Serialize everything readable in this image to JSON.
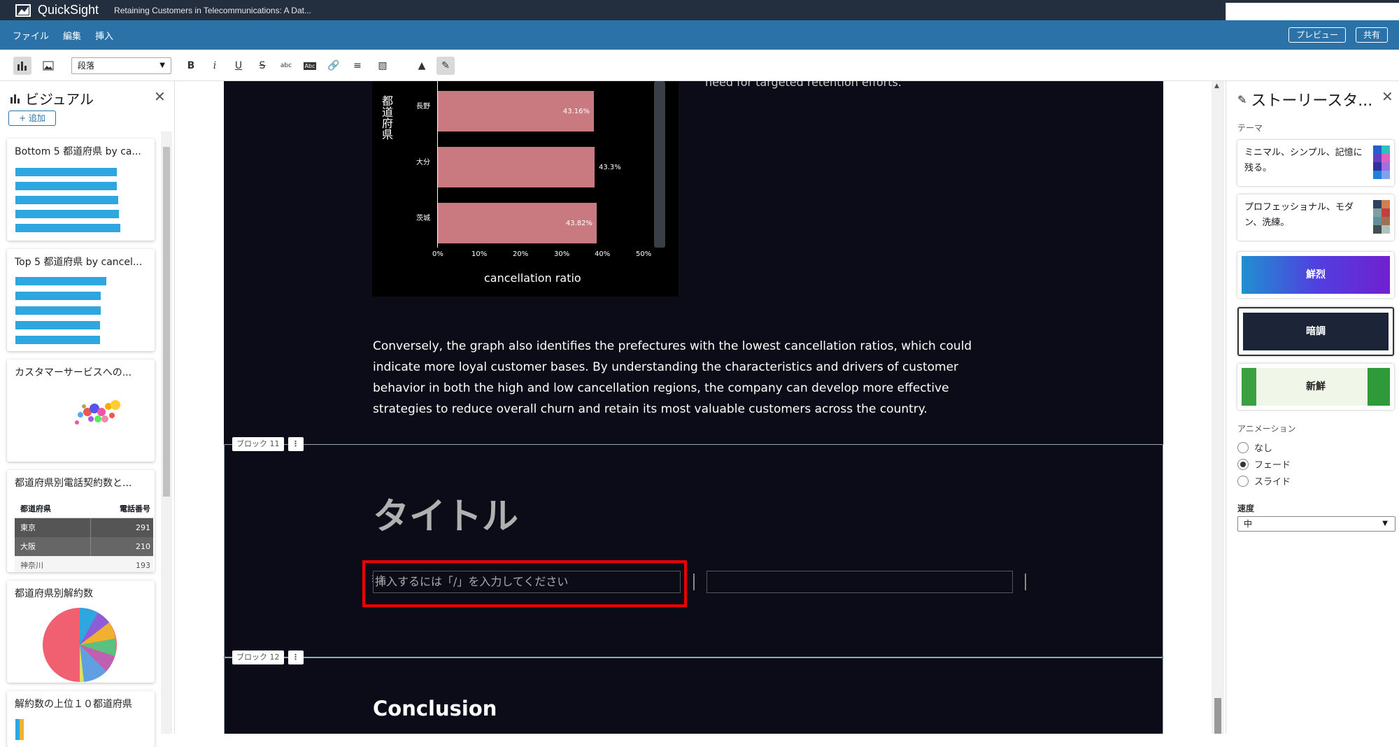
{
  "app": {
    "name": "QuickSight",
    "doc_title": "Retaining Customers in Telecommunications: A Dat..."
  },
  "menu": {
    "items": [
      "ファイル",
      "編集",
      "挿入"
    ],
    "preview": "プレビュー",
    "share": "共有"
  },
  "toolbar": {
    "paragraph_style": "段落"
  },
  "left_panel": {
    "title": "ビジュアル",
    "add_label": "+ 追加",
    "cards": [
      {
        "title": "Bottom 5 都道府県 by ca..."
      },
      {
        "title": "Top 5 都道府県 by cancel..."
      },
      {
        "title": "カスタマーサービスへの..."
      },
      {
        "title": "都道府県別電話契約数と...",
        "table": {
          "headers": [
            "都道府県",
            "電話番号"
          ],
          "rows": [
            [
              "東京",
              "291"
            ],
            [
              "大阪",
              "210"
            ],
            [
              "神奈川",
              "193"
            ]
          ]
        }
      },
      {
        "title": "都道府県別解約数"
      },
      {
        "title": "解約数の上位１０都道府県"
      }
    ]
  },
  "story": {
    "top_text": "need for targeted retention efforts.",
    "chart": {
      "ylabel": "都道府県",
      "xlabel": "cancellation ratio",
      "categories": [
        "長野",
        "大分",
        "茨城"
      ],
      "value_labels": [
        "43.16%",
        "43.3%",
        "43.82%"
      ],
      "ticks": [
        "0%",
        "10%",
        "20%",
        "30%",
        "40%",
        "50%"
      ]
    },
    "paragraph": "Conversely, the graph also identifies the prefectures with the lowest cancellation ratios, which could indicate more loyal customer bases. By understanding the characteristics and drivers of customer behavior in both the high and low cancellation regions, the company can develop more effective strategies to reduce overall churn and retain its most valuable customers across the country.",
    "block11_label": "ブロック 11",
    "block12_label": "ブロック 12",
    "block_title": "タイトル",
    "insert_placeholder": "挿入するには「/」を入力してください",
    "conclusion": "Conclusion"
  },
  "chart_data": {
    "type": "bar",
    "categories": [
      "長野",
      "大分",
      "茨城"
    ],
    "values": [
      43.16,
      43.3,
      43.82
    ],
    "xlabel": "cancellation ratio",
    "ylabel": "都道府県",
    "xlim": [
      0,
      50
    ],
    "unit": "%"
  },
  "right_panel": {
    "title": "ストーリースタ...",
    "theme_label": "テーマ",
    "themes": [
      "ミニマル、シンプル、記憶に残る。",
      "プロフェッショナル、モダン、洗練。",
      "鮮烈",
      "暗調",
      "新鮮"
    ],
    "animation_label": "アニメーション",
    "animation_options": [
      "なし",
      "フェード",
      "スライド"
    ],
    "animation_selected": "フェード",
    "speed_label": "速度",
    "speed_value": "中"
  }
}
